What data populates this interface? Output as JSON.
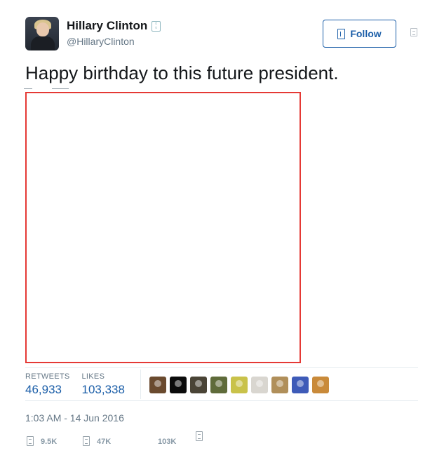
{
  "tweet": {
    "author": {
      "display_name": "Hillary Clinton",
      "handle": "@HillaryClinton",
      "verified_icon": "verified-badge-icon"
    },
    "follow_label": "Follow",
    "text": "Happy birthday to this future president.",
    "stats": {
      "retweets_label": "RETWEETS",
      "retweets_value": "46,933",
      "likes_label": "LIKES",
      "likes_value": "103,338"
    },
    "likers": [
      {
        "color": "#6a4a2e"
      },
      {
        "color": "#0b0b0b"
      },
      {
        "color": "#4a4436"
      },
      {
        "color": "#5f6b3a"
      },
      {
        "color": "#c9c24a"
      },
      {
        "color": "#d9d6d0"
      },
      {
        "color": "#b08f5a"
      },
      {
        "color": "#3e5bb8"
      },
      {
        "color": "#c98a3a"
      }
    ],
    "timestamp": "1:03 AM - 14 Jun 2016",
    "actions": {
      "reply_count": "9.5K",
      "retweet_count": "47K",
      "like_count": "103K"
    }
  },
  "colors": {
    "link_blue": "#1b5ea8",
    "media_border": "#e53935",
    "muted_text": "#657786"
  }
}
